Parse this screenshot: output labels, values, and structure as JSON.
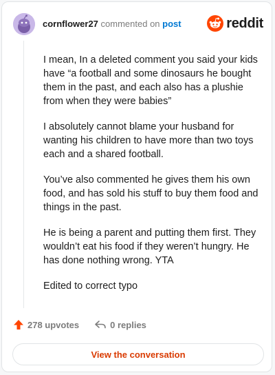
{
  "header": {
    "username": "cornflower27",
    "action": "commented on",
    "link_label": "post"
  },
  "brand": {
    "name": "reddit",
    "color": "#ff4500"
  },
  "comment": {
    "paragraphs": [
      "I mean, In a deleted comment you said your kids have “a football and some dinosaurs he bought them in the past, and each also has a plushie from when they were babies”",
      "I absolutely cannot blame your husband for wanting his children to have more than two toys each and a shared football.",
      "You’ve also commented he gives them his own food, and has sold his stuff to buy them food and things in the past.",
      "He is being a parent and putting them first. They wouldn’t eat his food if they weren’t hungry. He has done nothing wrong. YTA",
      "Edited to correct typo"
    ]
  },
  "footer": {
    "upvotes": "278 upvotes",
    "replies": "0 replies"
  },
  "cta": {
    "label": "View the conversation"
  },
  "colors": {
    "upvote": "#ff4500",
    "link": "#0079d3",
    "cta_text": "#d93a00"
  },
  "icons": {
    "avatar": "snoo-avatar",
    "upvote": "upvote-arrow-icon",
    "reply": "reply-arrow-icon",
    "logo": "reddit-snoo-icon"
  }
}
